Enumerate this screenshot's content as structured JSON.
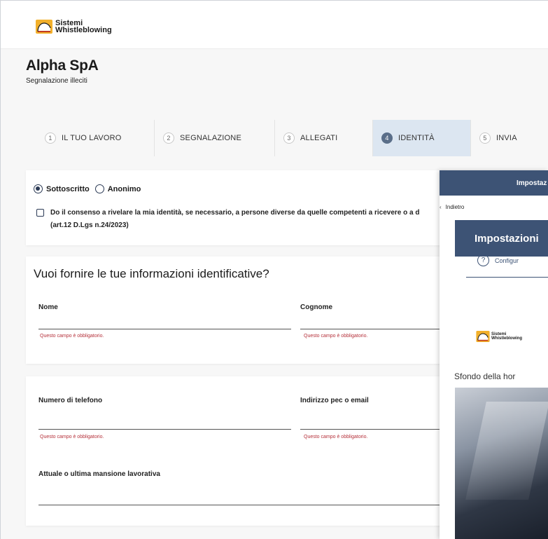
{
  "header": {
    "logo_line1": "Sistemi",
    "logo_line2": "Whistleblowing"
  },
  "company": {
    "name": "Alpha SpA",
    "subtitle": "Segnalazione illeciti"
  },
  "steps": [
    {
      "num": "1",
      "label": "IL TUO LAVORO",
      "active": false
    },
    {
      "num": "2",
      "label": "SEGNALAZIONE",
      "active": false
    },
    {
      "num": "3",
      "label": "ALLEGATI",
      "active": false
    },
    {
      "num": "4",
      "label": "IDENTITÀ",
      "active": true
    },
    {
      "num": "5",
      "label": "INVIA",
      "active": false
    }
  ],
  "identity": {
    "option_signed": "Sottoscritto",
    "option_anonymous": "Anonimo",
    "consent_line1": "Do il consenso a rivelare la mia identità, se necessario, a persone diverse da quelle competenti a ricevere o a d",
    "consent_line2": "(art.12 D.Lgs n.24/2023)"
  },
  "form": {
    "title": "Vuoi fornire le tue informazioni identificative?",
    "nome_label": "Nome",
    "cognome_label": "Cognome",
    "telefono_label": "Numero di telefono",
    "email_label": "Indirizzo pec o email",
    "mansione_label": "Attuale o ultima mansione lavorativa",
    "required_error": "Questo campo è obbligatorio."
  },
  "overlay": {
    "top_title": "Impostaz",
    "back_label": "Indietro",
    "heading": "Impostazioni",
    "config_label": "Configur",
    "logo_line1": "Sistemi",
    "logo_line2": "Whistleblowing",
    "background_label": "Sfondo della hor"
  },
  "colors": {
    "accent": "#3d5375",
    "active_step_bg": "#dce6f1",
    "error": "#b5303a"
  }
}
